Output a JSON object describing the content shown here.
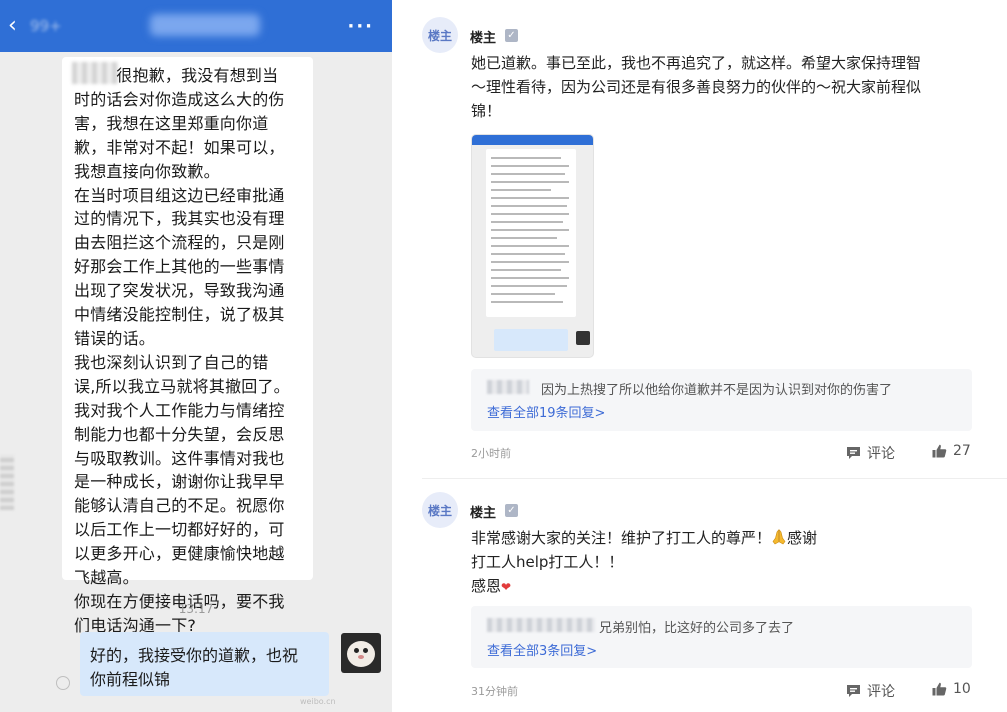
{
  "chat": {
    "back_count": "99+",
    "time": "13:17",
    "incoming_message": "        很抱歉，我没有想到当\n时的话会对你造成这么大的伤\n害，我想在这里郑重向你道\n歉，非常对不起！如果可以，\n我想直接向你致歉。\n在当时项目组这边已经审批通\n过的情况下，我其实也没有理\n由去阻拦这个流程的，只是刚\n好那会工作上其他的一些事情\n出现了突发状况，导致我沟通\n中情绪没能控制住，说了极其\n错误的话。\n我也深刻认识到了自己的错\n误,所以我立马就将其撤回了。\n我对我个人工作能力与情绪控\n制能力也都十分失望，会反思\n与吸取教训。这件事情对我也\n是一种成长，谢谢你让我早早\n能够认清自己的不足。祝愿你\n以后工作上一切都好好的，可\n以更多开心，更健康愉快地越\n飞越高。\n你现在方便接电话吗，要不我\n们电话沟通一下?",
    "outgoing_message": "好的，我接受你的道歉，也祝\n你前程似锦",
    "watermark": "weibo.cn"
  },
  "thread": {
    "posts": [
      {
        "avatar_label": "楼主",
        "name": "楼主",
        "text": "她已道歉。事已至此，我也不再追究了，就这样。希望大家保持理智\n～理性看待，因为公司还是有很多善良努力的伙伴的～祝大家前程似\n锦！",
        "reply_text": "因为上热搜了所以他给你道歉并不是因为认识到对你的伤害了",
        "reply_more": "查看全部19条回复>",
        "time": "2小时前",
        "comment_label": "评论",
        "likes": "27"
      },
      {
        "avatar_label": "楼主",
        "name": "楼主",
        "text_line1": "非常感谢大家的关注！维护了打工人的尊严！",
        "text_line1_tail": "感谢",
        "text_line2": "打工人help打工人！！",
        "text_line3": "感恩",
        "reply_text": "兄弟别怕，比这好的公司多了去了",
        "reply_more": "查看全部3条回复>",
        "time": "31分钟前",
        "comment_label": "评论",
        "likes": "10"
      }
    ]
  },
  "colors": {
    "accent_blue": "#2f6fd6",
    "link_blue": "#3d6bd6",
    "bubble_out": "#d7e8fb"
  }
}
